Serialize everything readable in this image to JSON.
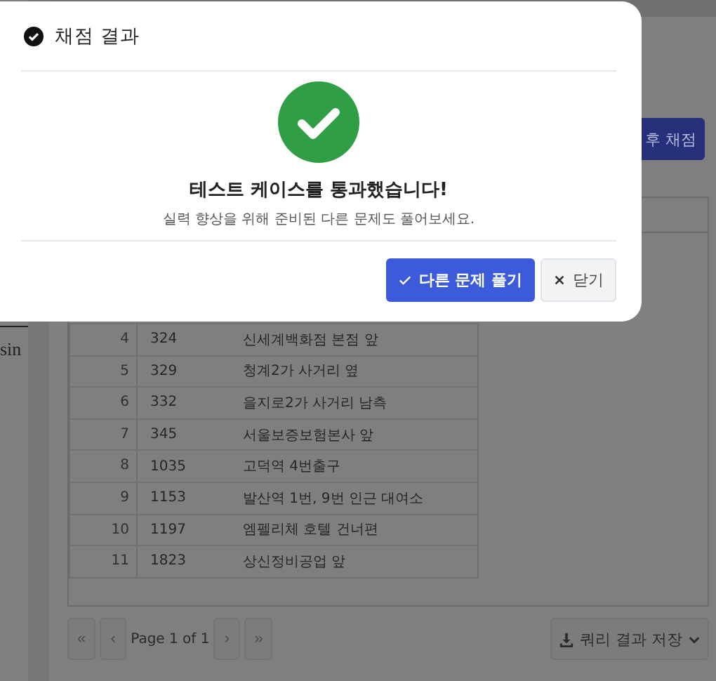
{
  "background": {
    "side_text": "sin",
    "grade_button": "후 채점",
    "rows": [
      {
        "index": "4",
        "id": "324",
        "name": "신세계백화점 본점 앞"
      },
      {
        "index": "5",
        "id": "329",
        "name": "청계2가 사거리 옆"
      },
      {
        "index": "6",
        "id": "332",
        "name": "을지로2가 사거리 남측"
      },
      {
        "index": "7",
        "id": "345",
        "name": "서울보증보험본사 앞"
      },
      {
        "index": "8",
        "id": "1035",
        "name": "고덕역 4번출구"
      },
      {
        "index": "9",
        "id": "1153",
        "name": "발산역 1번, 9번 인근 대여소"
      },
      {
        "index": "10",
        "id": "1197",
        "name": "엠펠리체 호텔 건너편"
      },
      {
        "index": "11",
        "id": "1823",
        "name": "상신정비공업 앞"
      }
    ],
    "pagination": {
      "before": [
        {
          "symbol": "«",
          "disabled": true
        },
        {
          "symbol": "‹",
          "disabled": true
        }
      ],
      "label": "Page 1 of 1",
      "after": [
        {
          "symbol": "›",
          "disabled": true
        },
        {
          "symbol": "»",
          "disabled": true
        }
      ]
    },
    "export_button": "쿼리 결과 저장"
  },
  "modal": {
    "title": "채점 결과",
    "headline": "테스트 케이스를 통과했습니다!",
    "message": "실력 향상을 위해 준비된 다른 문제도 풀어보세요.",
    "buttons": [
      {
        "kind": "primary",
        "label": "다른 문제 풀기"
      },
      {
        "kind": "close",
        "label": "닫기"
      }
    ]
  }
}
